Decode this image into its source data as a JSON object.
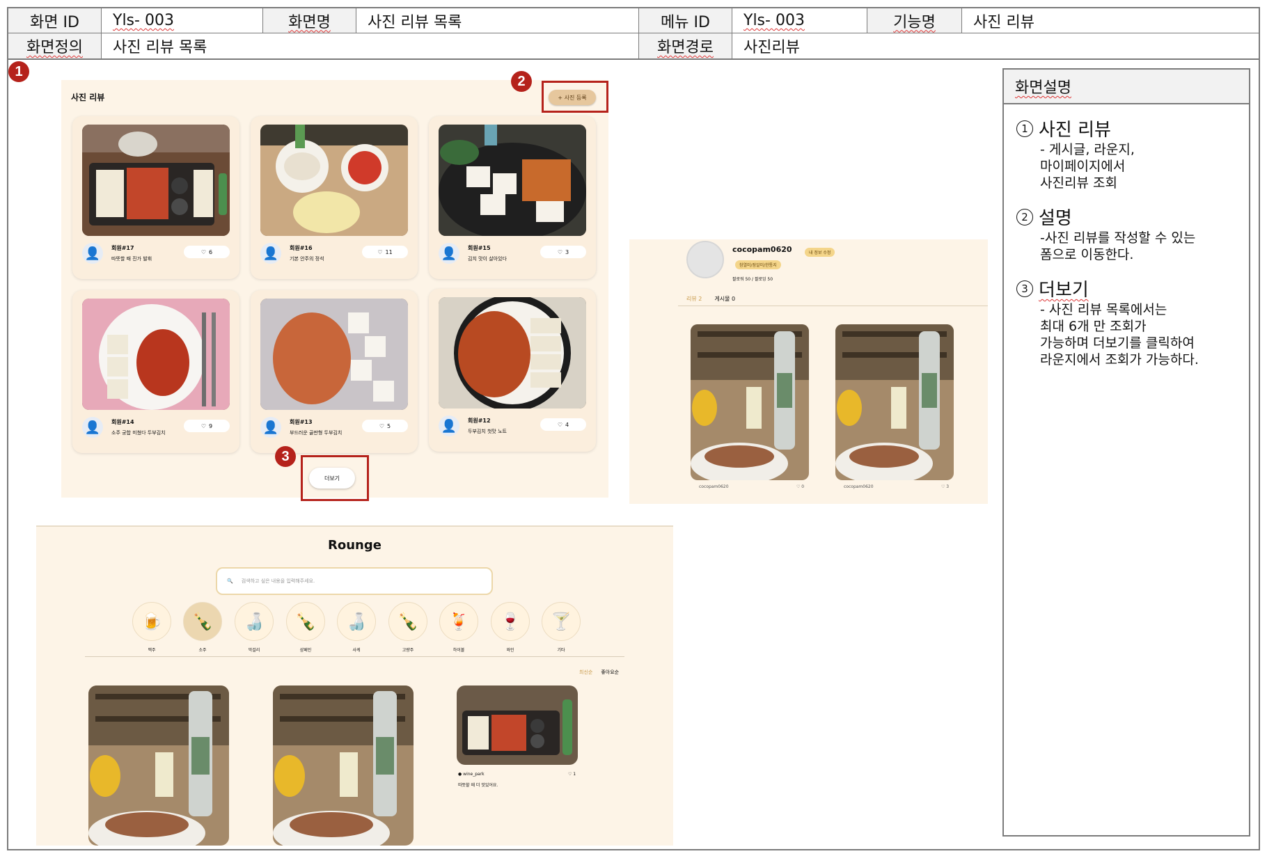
{
  "header": {
    "screen_id_label": "화면 ID",
    "screen_id": "Yls- 003",
    "screen_name_label": "화면명",
    "screen_name": "사진 리뷰 목록",
    "menu_id_label": "메뉴 ID",
    "menu_id": "Yls- 003",
    "feature_label": "기능명",
    "feature": "사진 리뷰",
    "definition_label": "화면정의",
    "definition": "사진 리뷰 목록",
    "path_label": "화면경로",
    "path": "사진리뷰"
  },
  "badges": [
    "1",
    "2",
    "3"
  ],
  "review_list": {
    "title": "사진 리뷰",
    "register_button": "+ 사진 등록",
    "more_button": "더보기",
    "cards": [
      {
        "name": "회원#17",
        "text": "따뜻할 때 진가 발휘",
        "likes": "6"
      },
      {
        "name": "회원#16",
        "text": "기본 안주의 정석",
        "likes": "11"
      },
      {
        "name": "회원#15",
        "text": "김치 맛이 살아있다",
        "likes": "3"
      },
      {
        "name": "회원#14",
        "text": "소주 궁합 미쳤다 두부김치",
        "likes": "9"
      },
      {
        "name": "회원#13",
        "text": "부드러운 골판형 두부김치",
        "likes": "5"
      },
      {
        "name": "회원#12",
        "text": "두부김치 첫맛 노트",
        "likes": "4"
      }
    ]
  },
  "mypage": {
    "username": "cocopam0620",
    "edit_tag": "내 정보 수정",
    "level_tag": "참열미/잠알미/한통지",
    "stats": "팔로워 50 / 팔로잉 50",
    "tabs": [
      "리뷰 2",
      "게시물 0"
    ],
    "posts": [
      {
        "user": "cocopam0620",
        "likes": "0"
      },
      {
        "user": "cocopam0620",
        "likes": "3"
      }
    ]
  },
  "lounge": {
    "title": "Rounge",
    "search_placeholder": "검색하고 싶은 내용을 입력해주세요.",
    "categories": [
      {
        "icon": "🍺",
        "label": "맥주"
      },
      {
        "icon": "🍾",
        "label": "소주"
      },
      {
        "icon": "🍶",
        "label": "막걸리"
      },
      {
        "icon": "🍾",
        "label": "샴페인"
      },
      {
        "icon": "🍶",
        "label": "사케"
      },
      {
        "icon": "🍾",
        "label": "고량주"
      },
      {
        "icon": "🍹",
        "label": "하이볼"
      },
      {
        "icon": "🍷",
        "label": "와인"
      },
      {
        "icon": "🍸",
        "label": "기타"
      }
    ],
    "sort": [
      "최신순",
      "좋아요순"
    ],
    "post3": {
      "user": "wine_park",
      "text": "따뜻할 때 더 맛있어요.",
      "likes": "1"
    }
  },
  "description": {
    "title": "화면설명",
    "items": [
      {
        "num": "1",
        "title": "사진 리뷰",
        "lines": [
          "- 게시글, 라운지,",
          "마이페이지에서",
          "사진리뷰 조회"
        ]
      },
      {
        "num": "2",
        "title": "설명",
        "lines": [
          "-사진 리뷰를 작성할 수 있는",
          "폼으로 이동한다."
        ]
      },
      {
        "num": "3",
        "title": "더보기",
        "lines": [
          "- 사진 리뷰 목록에서는",
          "최대 6개 만 조회가",
          "가능하며 더보기를 클릭하여",
          "라운지에서 조회가 가능하다."
        ]
      }
    ]
  }
}
